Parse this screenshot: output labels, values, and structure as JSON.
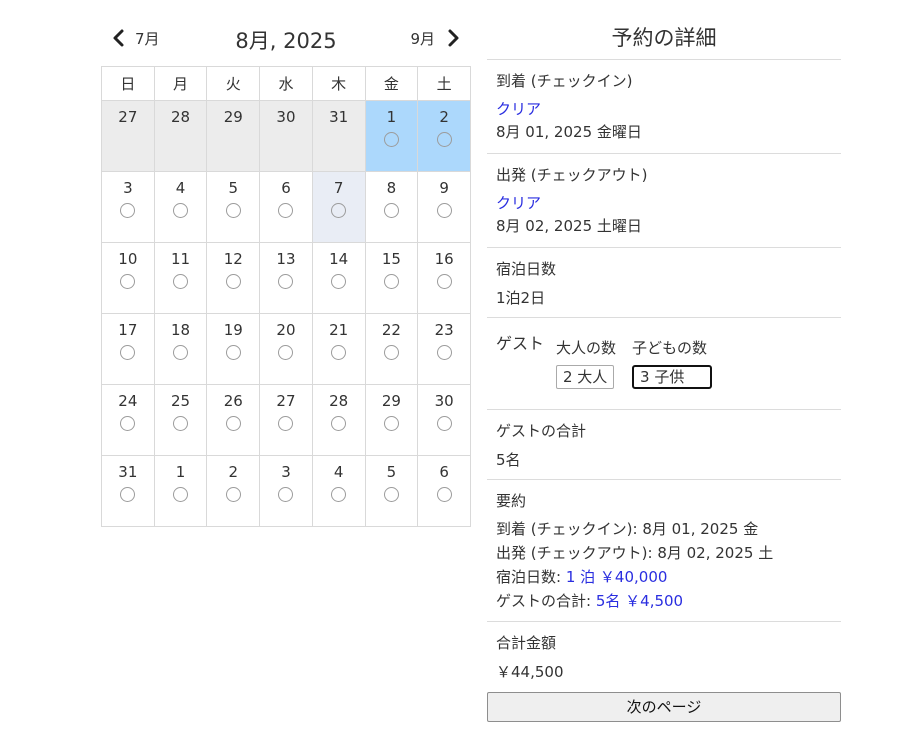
{
  "calendar": {
    "prev_label": "7月",
    "next_label": "9月",
    "title": "8月, 2025",
    "weekdays": [
      "日",
      "月",
      "火",
      "水",
      "木",
      "金",
      "土"
    ],
    "weeks": [
      [
        {
          "d": "27",
          "s": "past"
        },
        {
          "d": "28",
          "s": "past"
        },
        {
          "d": "29",
          "s": "past"
        },
        {
          "d": "30",
          "s": "past"
        },
        {
          "d": "31",
          "s": "past"
        },
        {
          "d": "1",
          "s": "sel"
        },
        {
          "d": "2",
          "s": "sel"
        }
      ],
      [
        {
          "d": "3",
          "s": ""
        },
        {
          "d": "4",
          "s": ""
        },
        {
          "d": "5",
          "s": ""
        },
        {
          "d": "6",
          "s": ""
        },
        {
          "d": "7",
          "s": "today"
        },
        {
          "d": "8",
          "s": ""
        },
        {
          "d": "9",
          "s": ""
        }
      ],
      [
        {
          "d": "10",
          "s": ""
        },
        {
          "d": "11",
          "s": ""
        },
        {
          "d": "12",
          "s": ""
        },
        {
          "d": "13",
          "s": ""
        },
        {
          "d": "14",
          "s": ""
        },
        {
          "d": "15",
          "s": ""
        },
        {
          "d": "16",
          "s": ""
        }
      ],
      [
        {
          "d": "17",
          "s": ""
        },
        {
          "d": "18",
          "s": ""
        },
        {
          "d": "19",
          "s": ""
        },
        {
          "d": "20",
          "s": ""
        },
        {
          "d": "21",
          "s": ""
        },
        {
          "d": "22",
          "s": ""
        },
        {
          "d": "23",
          "s": ""
        }
      ],
      [
        {
          "d": "24",
          "s": ""
        },
        {
          "d": "25",
          "s": ""
        },
        {
          "d": "26",
          "s": ""
        },
        {
          "d": "27",
          "s": ""
        },
        {
          "d": "28",
          "s": ""
        },
        {
          "d": "29",
          "s": ""
        },
        {
          "d": "30",
          "s": ""
        }
      ],
      [
        {
          "d": "31",
          "s": ""
        },
        {
          "d": "1",
          "s": ""
        },
        {
          "d": "2",
          "s": ""
        },
        {
          "d": "3",
          "s": ""
        },
        {
          "d": "4",
          "s": ""
        },
        {
          "d": "5",
          "s": ""
        },
        {
          "d": "6",
          "s": ""
        }
      ]
    ]
  },
  "details": {
    "title": "予約の詳細",
    "checkin": {
      "label": "到着 (チェックイン)",
      "clear": "クリア",
      "value": "8月 01, 2025 金曜日"
    },
    "checkout": {
      "label": "出発 (チェックアウト)",
      "clear": "クリア",
      "value": "8月 02, 2025 土曜日"
    },
    "nights": {
      "label": "宿泊日数",
      "value": "1泊2日"
    },
    "guests": {
      "label": "ゲスト",
      "adults_label": "大人の数",
      "adults_value": "2 大人",
      "children_label": "子どもの数",
      "children_value": "3 子供"
    },
    "guest_total": {
      "label": "ゲストの合計",
      "value": "5名"
    },
    "summary": {
      "label": "要約",
      "checkin_label": "到着 (チェックイン):",
      "checkin_value": "8月 01, 2025 金",
      "checkout_label": "出発 (チェックアウト):",
      "checkout_value": "8月 02, 2025 土",
      "nights_label": "宿泊日数:",
      "nights_value": "1 泊 ￥40,000",
      "guests_label": "ゲストの合計:",
      "guests_value": "5名 ￥4,500"
    },
    "total": {
      "label": "合計金額",
      "value": "￥44,500"
    },
    "next_button": "次のページ"
  }
}
